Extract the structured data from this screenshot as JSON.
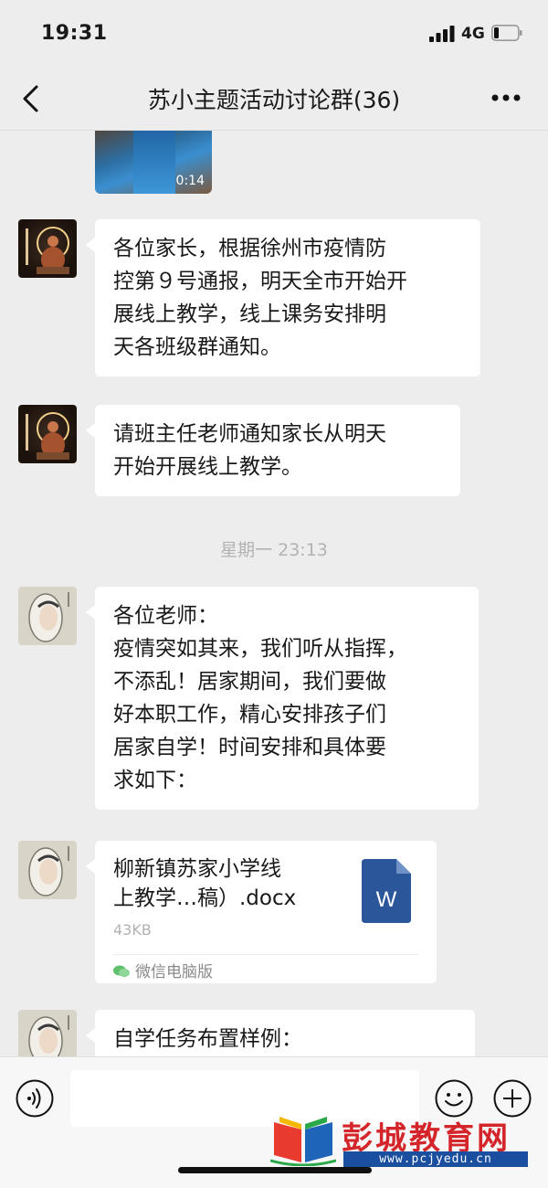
{
  "status_bar": {
    "time": "19:31",
    "network": "4G"
  },
  "header": {
    "title": "苏小主题活动讨论群(36)"
  },
  "messages": {
    "video": {
      "duration": "0:14"
    },
    "msg1": {
      "lines": [
        "各位家长，根据徐州市疫情防",
        "控第９号通报，明天全市开始开",
        "展线上教学，线上课务安排明",
        "天各班级群通知。"
      ]
    },
    "msg2": {
      "lines": [
        "请班主任老师通知家长从明天",
        "开始开展线上教学。"
      ]
    },
    "timestamp": "星期一 23:13",
    "msg3": {
      "lines": [
        "各位老师：",
        "疫情突如其来，我们听从指挥，",
        "不添乱！居家期间，我们要做",
        "好本职工作，精心安排孩子们",
        "居家自学！时间安排和具体要",
        "求如下："
      ]
    },
    "file": {
      "name_line1": "柳新镇苏家小学线",
      "name_line2": "上教学…稿）.docx",
      "size": "43KB",
      "icon_letter": "W",
      "source": "微信电脑版"
    },
    "msg4": {
      "lines": [
        "自学任务布置样例："
      ]
    }
  },
  "watermark": {
    "name": "彭城教育网",
    "url": "www.pcjyedu.cn"
  },
  "colors": {
    "background": "#ededed",
    "bubble": "#ffffff",
    "word_blue": "#2b579a",
    "watermark_red": "#d4262a"
  }
}
